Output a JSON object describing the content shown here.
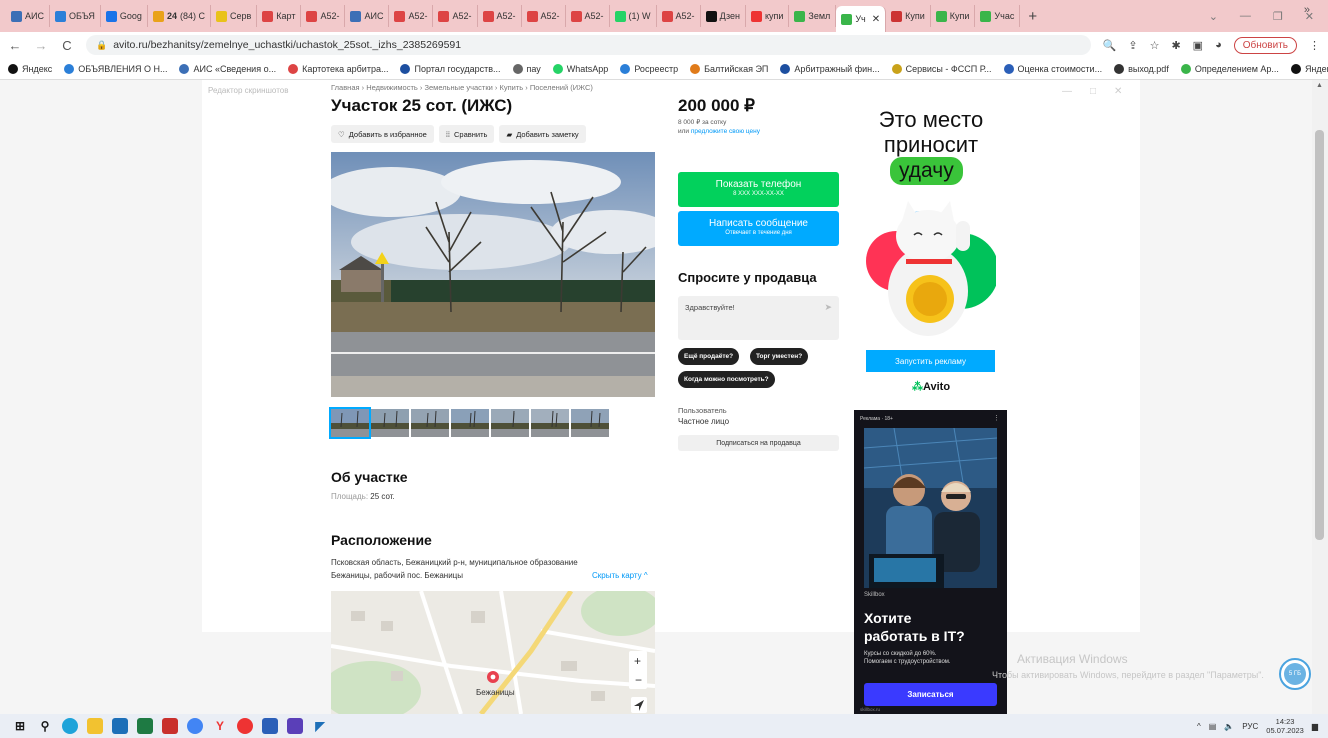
{
  "browser": {
    "tabs": [
      {
        "label": "АИС",
        "color": "#3c6fb6"
      },
      {
        "label": "ОБЪЯ",
        "color": "#2b7fd8"
      },
      {
        "label": "Goog",
        "color": "#1a73e8"
      },
      {
        "label": "(84) С",
        "color": "#e9a21a",
        "prefix": "24"
      },
      {
        "label": "Серв",
        "color": "#e9c21a"
      },
      {
        "label": "Карт",
        "color": "#d44"
      },
      {
        "label": "А52-",
        "color": "#d44"
      },
      {
        "label": "АИС",
        "color": "#3c6fb6"
      },
      {
        "label": "А52-",
        "color": "#d44"
      },
      {
        "label": "А52-",
        "color": "#d44"
      },
      {
        "label": "А52-",
        "color": "#d44"
      },
      {
        "label": "А52-",
        "color": "#d44"
      },
      {
        "label": "А52-",
        "color": "#d44"
      },
      {
        "label": "(1) W",
        "color": "#25d366"
      },
      {
        "label": "А52-",
        "color": "#d44"
      },
      {
        "label": "Дзен",
        "color": "#111"
      },
      {
        "label": "купи",
        "color": "#e33"
      },
      {
        "label": "Земл",
        "color": "#3ab54a"
      },
      {
        "label": "Уч",
        "color": "#3ab54a",
        "active": true
      },
      {
        "label": "Купи",
        "color": "#c33"
      },
      {
        "label": "Купи",
        "color": "#3ab54a"
      },
      {
        "label": "Учас",
        "color": "#3ab54a"
      }
    ],
    "url": "avito.ru/bezhanitsy/zemelnye_uchastki/uchastok_25sot._izhs_2385269591",
    "update_label": "Обновить",
    "bookmarks": [
      {
        "label": "Яндекс",
        "color": "#111"
      },
      {
        "label": "ОБЪЯВЛЕНИЯ О Н...",
        "color": "#2b7fd8"
      },
      {
        "label": "АИС «Сведения о...",
        "color": "#3c6fb6"
      },
      {
        "label": "Картотека арбитра...",
        "color": "#d44"
      },
      {
        "label": "Портал государств...",
        "color": "#1d4fa0"
      },
      {
        "label": "пау",
        "color": "#666"
      },
      {
        "label": "WhatsApp",
        "color": "#25d366"
      },
      {
        "label": "Росреестр",
        "color": "#2b7fd8"
      },
      {
        "label": "Балтийская ЭП",
        "color": "#e07b1a"
      },
      {
        "label": "Арбитражный фин...",
        "color": "#1d4fa0"
      },
      {
        "label": "Сервисы - ФССП Р...",
        "color": "#c9a21a"
      },
      {
        "label": "Оценка стоимости...",
        "color": "#2b5fb8"
      },
      {
        "label": "выход.pdf",
        "color": "#333"
      },
      {
        "label": "Определением Ар...",
        "color": "#3ab54a"
      },
      {
        "label": "Яндекс",
        "color": "#111"
      }
    ]
  },
  "page": {
    "ghost_label": "Редактор скриншотов",
    "breadcrumbs": "Главная › Недвижимость › Земельные участки › Купить › Поселений (ИЖС)",
    "title": "Участок 25 сот. (ИЖС)",
    "actions": {
      "favorite": "Добавить в избранное",
      "compare": "Сравнить",
      "note": "Добавить заметку"
    },
    "price": "200 000 ₽",
    "price_per": "8 000 ₽ за сотку",
    "price_offer_prefix": "или",
    "price_offer_link": "предложите свою цену",
    "show_phone": "Показать телефон",
    "phone_masked": "8 XXX XXX-XX-XX",
    "write_message": "Написать сообщение",
    "reply_time": "Отвечает в течение дня",
    "ask_title": "Спросите у продавца",
    "message_placeholder": "Здравствуйте!",
    "quick_questions": [
      "Ещё продаёте?",
      "Торг уместен?",
      "Когда можно посмотреть?"
    ],
    "seller_role": "Пользователь",
    "seller_type": "Частное лицо",
    "subscribe": "Подписаться на продавца",
    "about_title": "Об участке",
    "area_label": "Площадь:",
    "area_value": "25 сот.",
    "location_title": "Расположение",
    "address_line1": "Псковская область, Бежаницкий р-н, муниципальное образование",
    "address_line2": "Бежаницы, рабочий пос. Бежаницы",
    "hide_map": "Скрыть карту",
    "map_place": "Бежаницы"
  },
  "ads": {
    "ad1_line1": "Это место",
    "ad1_line2": "приносит",
    "ad1_highlight": "удачу",
    "ad1_button": "Запустить рекламу",
    "ad1_logo": "Avito",
    "ad2_label": "Реклама · 18+",
    "ad2_brand": "Skillbox",
    "ad2_heading_1": "Хотите",
    "ad2_heading_2": "работать в IT?",
    "ad2_text_1": "Курсы со скидкой до 60%.",
    "ad2_text_2": "Помогаем с трудоустройством.",
    "ad2_button": "Записаться",
    "ad2_domain": "skillbox.ru"
  },
  "watermark": {
    "line1": "Активация Windows",
    "line2": "Чтобы активировать Windows, перейдите в раздел \"Параметры\".",
    "badge": "5 ГБ"
  },
  "taskbar": {
    "lang": "РУС",
    "time": "14:23",
    "date": "05.07.2023"
  }
}
